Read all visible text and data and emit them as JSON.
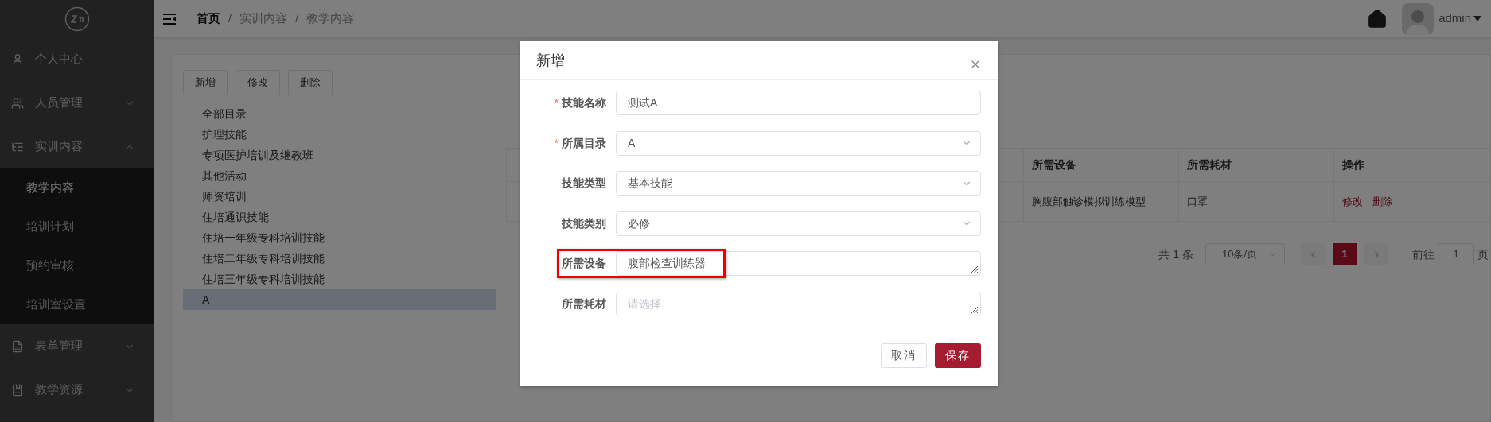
{
  "sidebar": {
    "items": [
      {
        "label": "个人中心",
        "kind": "link"
      },
      {
        "label": "人员管理",
        "kind": "group",
        "expanded": false
      },
      {
        "label": "实训内容",
        "kind": "group",
        "expanded": true,
        "children": [
          {
            "label": "教学内容",
            "selected": true
          },
          {
            "label": "培训计划",
            "selected": false
          },
          {
            "label": "预约审核",
            "selected": false
          },
          {
            "label": "培训室设置",
            "selected": false
          }
        ]
      },
      {
        "label": "表单管理",
        "kind": "group",
        "expanded": false
      },
      {
        "label": "教学资源",
        "kind": "group",
        "expanded": false
      }
    ]
  },
  "header": {
    "breadcrumb": [
      "首页",
      "实训内容",
      "教学内容"
    ],
    "separator": "/",
    "user": "admin"
  },
  "toolbar": {
    "buttons": [
      "新增",
      "修改",
      "删除"
    ]
  },
  "tree": {
    "items": [
      {
        "label": "全部目录",
        "selected": false
      },
      {
        "label": "护理技能",
        "selected": false
      },
      {
        "label": "专项医护培训及继教班",
        "selected": false
      },
      {
        "label": "其他活动",
        "selected": false
      },
      {
        "label": "师资培训",
        "selected": false
      },
      {
        "label": "住培通识技能",
        "selected": false
      },
      {
        "label": "住培一年级专科培训技能",
        "selected": false
      },
      {
        "label": "住培二年级专科培训技能",
        "selected": false
      },
      {
        "label": "住培三年级专科培训技能",
        "selected": false
      },
      {
        "label": "A",
        "selected": true
      }
    ]
  },
  "table": {
    "columns": [
      "所需设备",
      "所需耗材",
      "操作"
    ],
    "rows": [
      {
        "cells": [
          "胸腹部触诊模拟训练模型",
          "口罩"
        ],
        "actions": [
          "修改",
          "删除"
        ]
      }
    ]
  },
  "pagination": {
    "total": "共 1 条",
    "page_size": "10条/页",
    "pages": [
      {
        "label": "1",
        "selected": true
      }
    ],
    "goto_label": "前往",
    "goto_value": "1",
    "goto_suffix": "页"
  },
  "dialog": {
    "title": "新增",
    "required_mark": "*",
    "fields": [
      {
        "label": "技能名称",
        "required": true,
        "kind": "input",
        "value": "测试A",
        "highlighted": false
      },
      {
        "label": "所属目录",
        "required": true,
        "kind": "select",
        "value": "A",
        "highlighted": false
      },
      {
        "label": "技能类型",
        "required": false,
        "kind": "select",
        "value": "基本技能",
        "highlighted": false
      },
      {
        "label": "技能类别",
        "required": false,
        "kind": "select",
        "value": "必修",
        "highlighted": false
      },
      {
        "label": "所需设备",
        "required": false,
        "kind": "textarea",
        "value": "腹部检查训练器",
        "highlighted": true
      },
      {
        "label": "所需耗材",
        "required": false,
        "kind": "textarea",
        "placeholder": "请选择",
        "highlighted": false
      }
    ],
    "buttons": [
      {
        "label": "取消",
        "kind": "default"
      },
      {
        "label": "保存",
        "kind": "primary"
      }
    ]
  }
}
